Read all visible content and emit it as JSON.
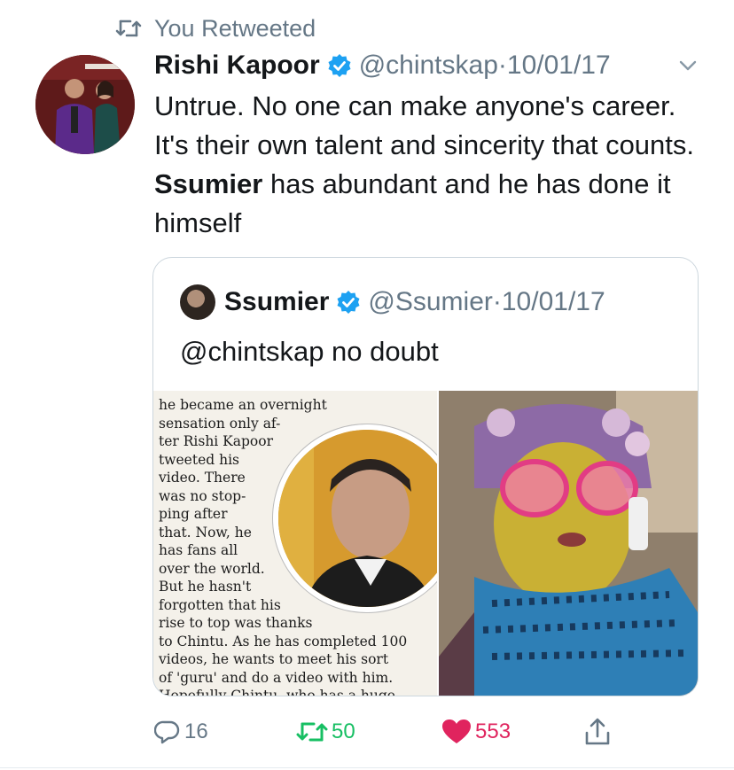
{
  "retweet_banner": {
    "label": "You Retweeted"
  },
  "tweet": {
    "author_name": "Rishi Kapoor",
    "handle": "@chintskap",
    "separator": "·",
    "date": "10/01/17",
    "text_parts": {
      "before_bold": "Untrue. No one can make anyone's career. It's their own talent and sincerity that counts.",
      "bold": "Ssumier",
      "after_bold": "has abundant and he has done it himself"
    }
  },
  "quoted_tweet": {
    "author_name": "Ssumier",
    "handle": "@Ssumier",
    "separator": "·",
    "date": "10/01/17",
    "text": "@chintskap  no doubt",
    "newspaper_lines": [
      "he became an overnight",
      "sensation only af-",
      "ter Rishi Kapoor",
      "tweeted his",
      "video. There",
      "was no stop-",
      "ping after",
      "that. Now, he",
      "has fans all",
      "over the world.",
      "But he hasn't",
      "forgotten that his",
      "rise to top was thanks",
      "to Chintu. As he has completed 100",
      "videos, he wants to meet his sort",
      "of 'guru' and do a video with him.",
      "Hopefully Chintu, who has a huge"
    ]
  },
  "actions": {
    "reply_count": "16",
    "retweet_count": "50",
    "like_count": "553"
  },
  "colors": {
    "verified": "#1da1f2",
    "retweet_active": "#17bf63",
    "like_active": "#e0245e",
    "secondary_text": "#657786"
  },
  "icons": [
    "retweet-icon",
    "verified-badge-icon",
    "chevron-down-icon",
    "reply-icon",
    "heart-icon",
    "share-icon"
  ]
}
